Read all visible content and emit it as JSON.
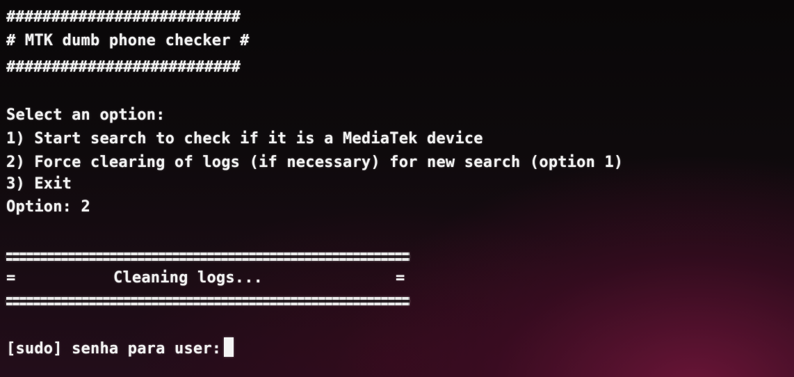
{
  "banner": {
    "top": "##########################",
    "title": "# MTK dumb phone checker #",
    "bottom": "##########################"
  },
  "menu": {
    "prompt": "Select an option:",
    "options": [
      "1) Start search to check if it is a MediaTek device",
      "2) Force clearing of logs (if necessary) for new search (option 1)",
      "3) Exit"
    ],
    "input": "Option: 2"
  },
  "status": {
    "left_edge": "=",
    "message": "Cleaning logs...",
    "right_edge": "="
  },
  "sudo_prompt": "[sudo] senha para user:"
}
